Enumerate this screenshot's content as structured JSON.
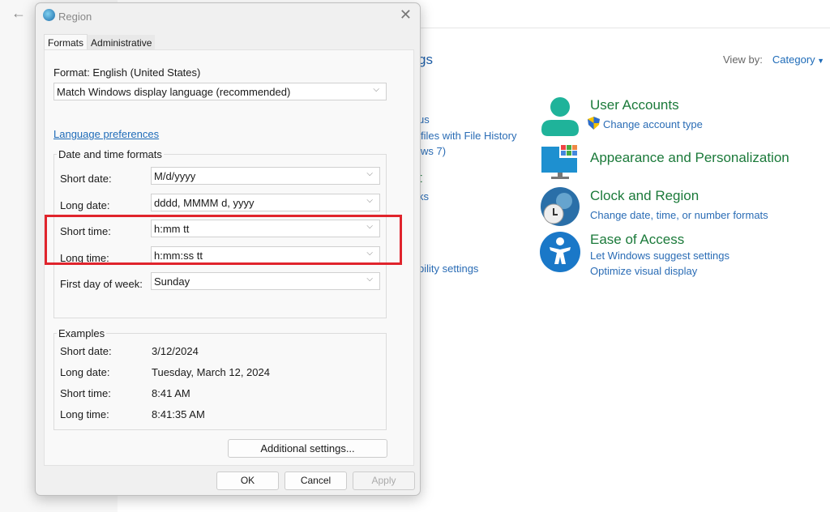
{
  "control_panel": {
    "title_fragment": "gs",
    "view_by_label": "View by:",
    "view_by_value": "Category",
    "left_fragments": [
      "us",
      "files with File History",
      "ws 7)",
      "t",
      "ks",
      "bility settings"
    ],
    "categories": [
      {
        "title": "User Accounts",
        "links": [
          "Change account type"
        ],
        "icon": "user-icon"
      },
      {
        "title": "Appearance and Personalization",
        "links": [],
        "icon": "monitor-icon"
      },
      {
        "title": "Clock and Region",
        "links": [
          "Change date, time, or number formats"
        ],
        "icon": "clock-globe-icon"
      },
      {
        "title": "Ease of Access",
        "links": [
          "Let Windows suggest settings",
          "Optimize visual display"
        ],
        "icon": "accessibility-icon"
      }
    ]
  },
  "dialog": {
    "title": "Region",
    "tabs": [
      "Formats",
      "Administrative"
    ],
    "active_tab": "Formats",
    "format_label": "Format: English (United States)",
    "format_value": "Match Windows display language (recommended)",
    "language_link": "Language preferences",
    "formats_group": "Date and time formats",
    "formats": [
      {
        "label": "Short date:",
        "value": "M/d/yyyy"
      },
      {
        "label": "Long date:",
        "value": "dddd, MMMM d, yyyy"
      },
      {
        "label": "Short time:",
        "value": "h:mm tt"
      },
      {
        "label": "Long time:",
        "value": "h:mm:ss tt"
      },
      {
        "label": "First day of week:",
        "value": "Sunday"
      }
    ],
    "examples_group": "Examples",
    "examples": [
      {
        "label": "Short date:",
        "value": "3/12/2024"
      },
      {
        "label": "Long date:",
        "value": "Tuesday, March 12, 2024"
      },
      {
        "label": "Short time:",
        "value": "8:41 AM"
      },
      {
        "label": "Long time:",
        "value": "8:41:35 AM"
      }
    ],
    "additional_settings": "Additional settings...",
    "ok": "OK",
    "cancel": "Cancel",
    "apply": "Apply"
  },
  "highlight_color": "#e0242c"
}
